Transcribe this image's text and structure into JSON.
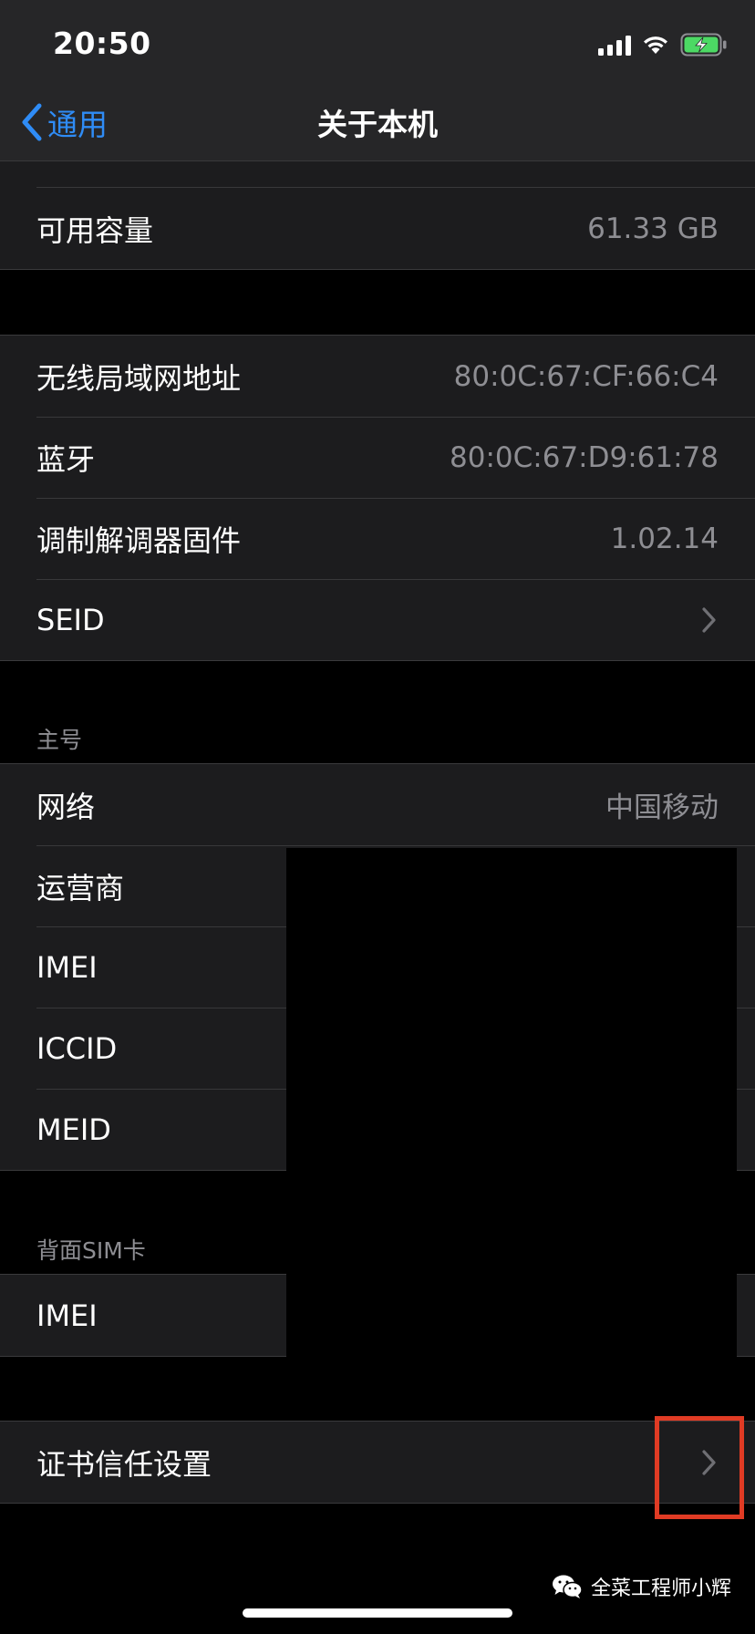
{
  "status_bar": {
    "time": "20:50",
    "icons": [
      "cellular-signal-icon",
      "wifi-icon",
      "battery-charging-icon"
    ],
    "battery_color": "#4cd964"
  },
  "nav": {
    "back_label": "通用",
    "title": "关于本机",
    "accent": "#2f8cf6"
  },
  "partial_row": {
    "label": "运营商"
  },
  "capacity": {
    "label": "可用容量",
    "value": "61.33 GB"
  },
  "network_info": [
    {
      "label": "无线局域网地址",
      "value": "80:0C:67:CF:66:C4"
    },
    {
      "label": "蓝牙",
      "value": "80:0C:67:D9:61:78"
    },
    {
      "label": "调制解调器固件",
      "value": "1.02.14"
    },
    {
      "label": "SEID",
      "value": ""
    }
  ],
  "primary_sim": {
    "header": "主号",
    "rows": [
      {
        "label": "网络",
        "value": "中国移动"
      },
      {
        "label": "运营商",
        "value": ""
      },
      {
        "label": "IMEI",
        "value": ""
      },
      {
        "label": "ICCID",
        "value": ""
      },
      {
        "label": "MEID",
        "value": ""
      }
    ]
  },
  "back_sim": {
    "header": "背面SIM卡",
    "rows": [
      {
        "label": "IMEI",
        "value": ""
      }
    ]
  },
  "cert": {
    "label": "证书信任设置"
  },
  "watermark": {
    "text": "全菜工程师小辉",
    "icon": "wechat-icon"
  },
  "colors": {
    "highlight": "#e03b24",
    "secondary_text": "#8e8e93"
  }
}
